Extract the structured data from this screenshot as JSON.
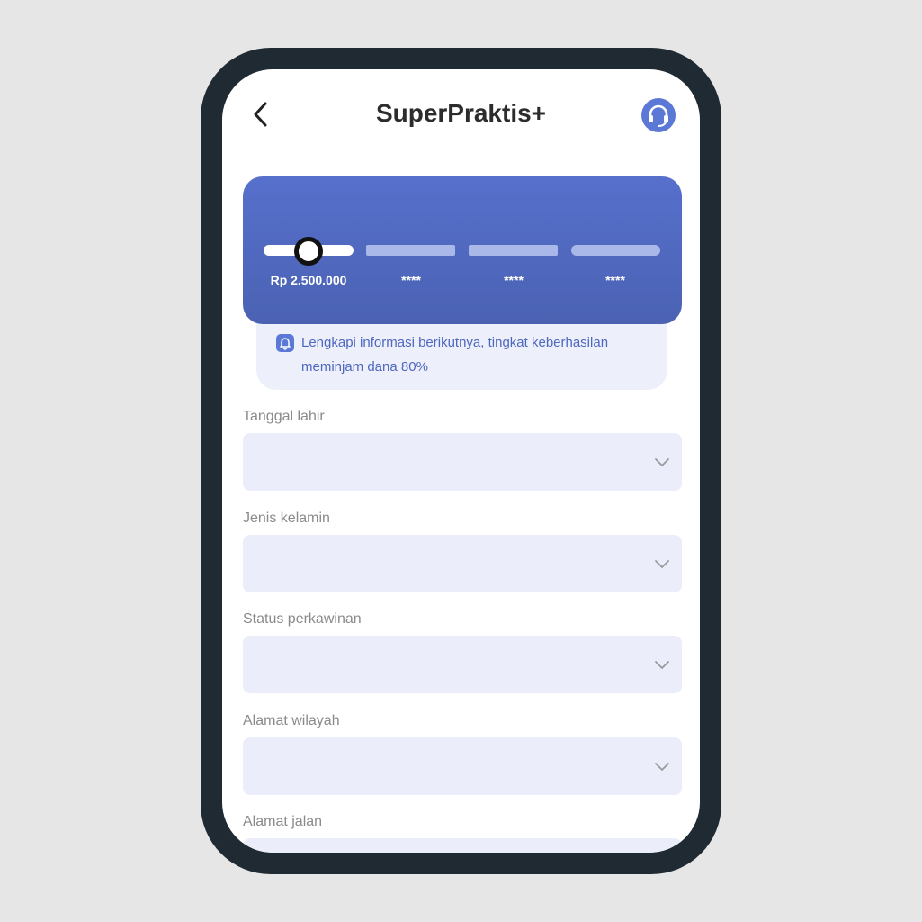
{
  "header": {
    "title": "SuperPraktis+",
    "back_icon": "chevron-left-icon",
    "support_icon": "headset-icon"
  },
  "progress_card": {
    "steps": [
      "Rp 2.500.000",
      "****",
      "****",
      "****"
    ],
    "current_step": 1,
    "slider_fraction_of_first_step": 0.5,
    "colors": {
      "card": "#5670cc",
      "track_active": "#ffffff",
      "track_inactive": "#a9b8e8"
    }
  },
  "notice": {
    "icon": "bell-icon",
    "text": "Lengkapi informasi berikutnya, tingkat keberhasilan meminjam dana 80%"
  },
  "form": {
    "fields": [
      {
        "label": "Tanggal lahir",
        "value": ""
      },
      {
        "label": "Jenis kelamin",
        "value": ""
      },
      {
        "label": "Status perkawinan",
        "value": ""
      },
      {
        "label": "Alamat wilayah",
        "value": ""
      },
      {
        "label": "Alamat jalan",
        "value": ""
      }
    ]
  },
  "colors": {
    "accent": "#5b78d6",
    "field_bg": "#ebeefa",
    "frame": "#1f2a33"
  }
}
